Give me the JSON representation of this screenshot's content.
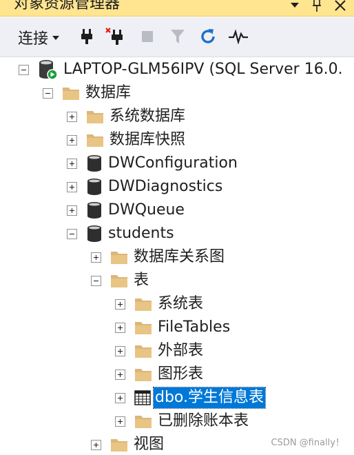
{
  "window": {
    "title": "对象资源管理器",
    "pin_icon": "pin-icon",
    "dropdown_icon": "chevron-down-icon",
    "close_icon": "close-icon"
  },
  "toolbar": {
    "connect_label": "连接",
    "tools": [
      "connect-plug-icon",
      "disconnect-plug-icon",
      "stop-icon",
      "filter-icon",
      "refresh-icon",
      "activity-monitor-icon"
    ]
  },
  "tree": {
    "server": "LAPTOP-GLM56IPV (SQL Server 16.0.",
    "databases": "数据库",
    "system_databases": "系统数据库",
    "snapshots": "数据库快照",
    "db_dwconfiguration": "DWConfiguration",
    "db_dwdiagnostics": "DWDiagnostics",
    "db_dwqueue": "DWQueue",
    "db_students": "students",
    "diagrams": "数据库关系图",
    "tables": "表",
    "system_tables": "系统表",
    "filetables": "FileTables",
    "external_tables": "外部表",
    "graph_tables": "图形表",
    "student_table": "dbo.学生信息表",
    "dropped_ledger": "已删除账本表",
    "views": "视图"
  },
  "colors": {
    "titlebar": "#ffe58f",
    "toolbar": "#eef0f5",
    "selection": "#0078d7",
    "folder": "#dcb67a"
  },
  "watermark": "CSDN @finally！"
}
